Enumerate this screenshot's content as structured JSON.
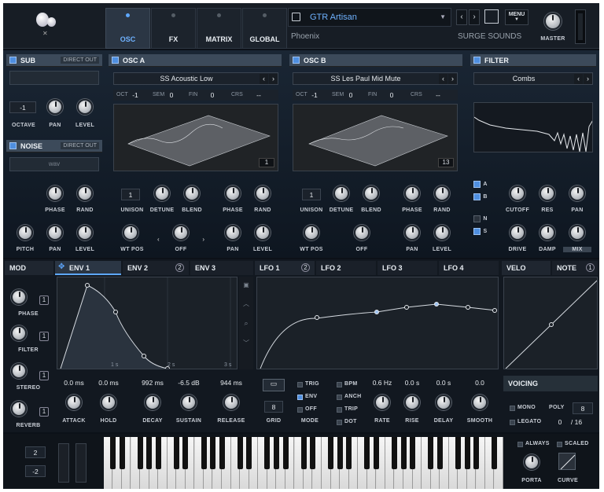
{
  "top": {
    "tabs": [
      "OSC",
      "FX",
      "MATRIX",
      "GLOBAL"
    ],
    "patch_name": "GTR Artisan",
    "author": "Phoenix",
    "category": "SURGE SOUNDS",
    "menu_label": "MENU",
    "master_label": "MASTER"
  },
  "sub": {
    "title": "SUB",
    "direct_out": "DIRECT OUT",
    "octave_value": "-1",
    "labels": [
      "OCTAVE",
      "PAN",
      "LEVEL"
    ]
  },
  "noise": {
    "title": "NOISE",
    "direct_out": "DIRECT OUT",
    "type": "wav",
    "labels": [
      "PHASE",
      "RAND",
      "PITCH",
      "PAN",
      "LEVEL"
    ]
  },
  "osc_a": {
    "title": "OSC A",
    "wavetable": "SS Acoustic Low",
    "oct": "OCT",
    "oct_val": "-1",
    "sem": "SEM",
    "sem_val": "0",
    "fin": "FIN",
    "fin_val": "0",
    "crs": "CRS",
    "crs_val": "--",
    "frame": "1",
    "unison_val": "1",
    "row1": [
      "UNISON",
      "DETUNE",
      "BLEND",
      "PHASE",
      "RAND"
    ],
    "row2": [
      "WT POS",
      "OFF",
      "PAN",
      "LEVEL"
    ]
  },
  "osc_b": {
    "title": "OSC B",
    "wavetable": "SS Les Paul Mid Mute",
    "oct": "OCT",
    "oct_val": "-1",
    "sem": "SEM",
    "sem_val": "0",
    "fin": "FIN",
    "fin_val": "0",
    "crs": "CRS",
    "crs_val": "--",
    "frame": "13",
    "unison_val": "1",
    "row1": [
      "UNISON",
      "DETUNE",
      "BLEND",
      "PHASE",
      "RAND"
    ],
    "row2": [
      "WT POS",
      "OFF",
      "PAN",
      "LEVEL"
    ]
  },
  "filter": {
    "title": "FILTER",
    "type": "Combs",
    "a": "A",
    "b": "B",
    "n": "N",
    "s": "S",
    "labels": [
      "CUTOFF",
      "RES",
      "PAN",
      "DRIVE",
      "DAMP",
      "MIX"
    ]
  },
  "mod": {
    "title": "MOD",
    "labels": [
      "PHASE",
      "FILTER",
      "STEREO",
      "REVERB"
    ],
    "badges": [
      "1",
      "1",
      "1",
      "1"
    ]
  },
  "env": {
    "tabs": [
      "ENV 1",
      "ENV 2",
      "ENV 3"
    ],
    "env2_badge": "2",
    "ticks": [
      "1 s",
      "2 s",
      "3 s"
    ],
    "values": [
      "0.0 ms",
      "0.0 ms",
      "992 ms",
      "-6.5 dB",
      "944 ms"
    ],
    "labels": [
      "ATTACK",
      "HOLD",
      "DECAY",
      "SUSTAIN",
      "RELEASE"
    ]
  },
  "lfo": {
    "tabs": [
      "LFO 1",
      "LFO 2",
      "LFO 3",
      "LFO 4"
    ],
    "lfo1_badge": "2",
    "grid_val": "8",
    "grid": "GRID",
    "mode": "MODE",
    "mode_opts": [
      "TRIG",
      "ENV",
      "OFF"
    ],
    "opts2": [
      "BPM",
      "ANCH",
      "TRIP",
      "DOT"
    ],
    "values": [
      "0.6 Hz",
      "0.0 s",
      "0.0 s",
      "0.0"
    ],
    "labels": [
      "RATE",
      "RISE",
      "DELAY",
      "SMOOTH"
    ]
  },
  "velo": {
    "tabs": [
      "VELO",
      "NOTE"
    ],
    "note_badge": "1"
  },
  "voicing": {
    "title": "VOICING",
    "mono": "MONO",
    "poly": "POLY",
    "poly_val": "8",
    "legato": "LEGATO",
    "count": "0",
    "count_max": "/ 16"
  },
  "keyboard": {
    "spin1": "2",
    "spin2": "-2",
    "always": "ALWAYS",
    "scaled": "SCALED",
    "porta": "PORTA",
    "curve": "CURVE"
  }
}
